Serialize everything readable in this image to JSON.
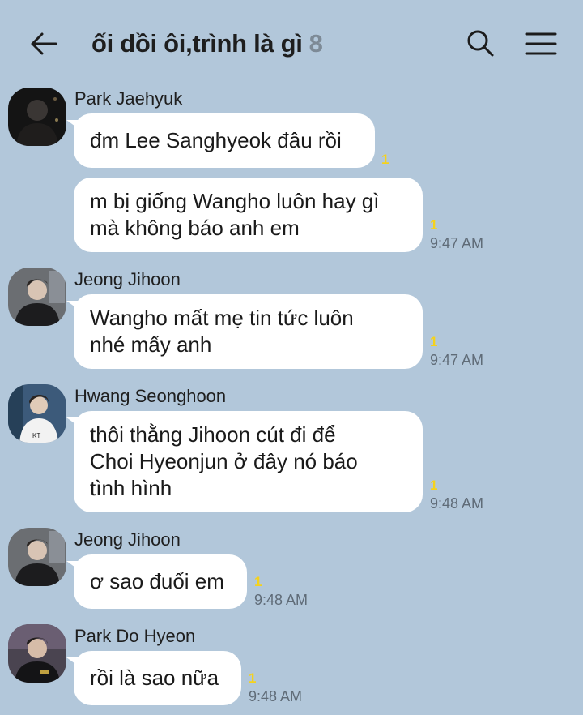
{
  "header": {
    "title": "ối dồi ôi,trình là gì",
    "member_count": "8",
    "back_icon": "arrow-left-icon",
    "search_icon": "search-icon",
    "menu_icon": "menu-icon"
  },
  "colors": {
    "background": "#b2c7da",
    "bubble": "#ffffff",
    "unread": "#f5d21c"
  },
  "messages": [
    {
      "sender": "Park Jaehyuk",
      "text": "đm Lee Sanghyeok đâu rồi",
      "unread": "1",
      "time": ""
    },
    {
      "sender": "",
      "text": "m bị giống Wangho luôn hay gì\nmà không báo anh em",
      "unread": "1",
      "time": "9:47 AM"
    },
    {
      "sender": "Jeong Jihoon",
      "text": "Wangho mất mẹ tin tức luôn\nnhé mấy anh",
      "unread": "1",
      "time": "9:47 AM"
    },
    {
      "sender": "Hwang Seonghoon",
      "text": "thôi thằng Jihoon cút đi để\nChoi Hyeonjun ở đây nó báo\ntình hình",
      "unread": "1",
      "time": "9:48 AM"
    },
    {
      "sender": "Jeong Jihoon",
      "text": "ơ sao đuổi em",
      "unread": "1",
      "time": "9:48 AM"
    },
    {
      "sender": "Park Do Hyeon",
      "text": "rồi là sao nữa",
      "unread": "1",
      "time": "9:48 AM"
    }
  ]
}
